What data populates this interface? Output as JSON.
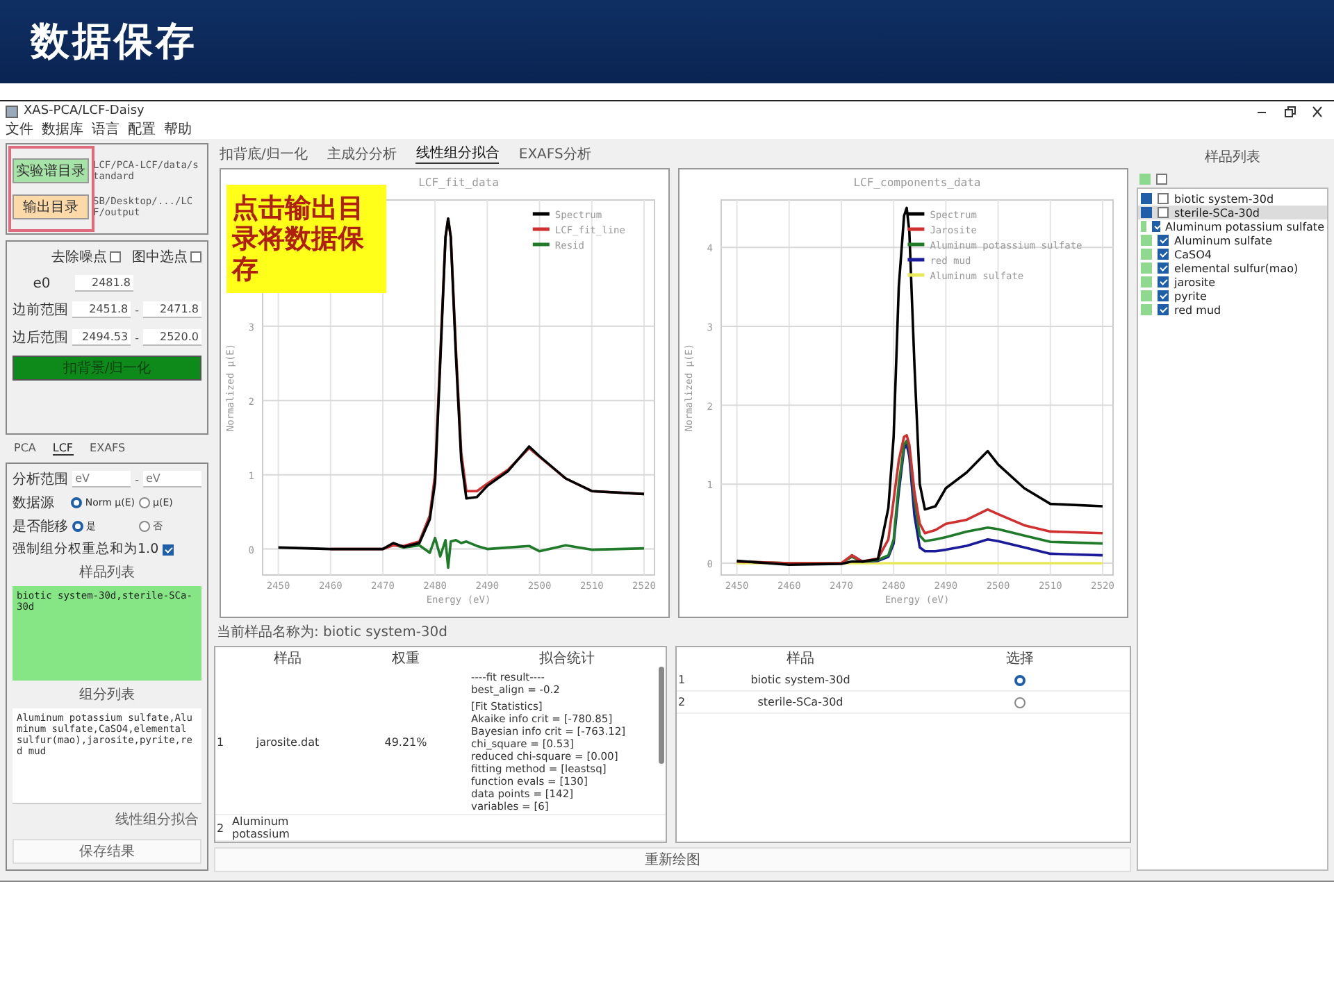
{
  "slide": {
    "title": "数据保存"
  },
  "window": {
    "title": "XAS-PCA/LCF-Daisy"
  },
  "menu": [
    "文件",
    "数据库",
    "语言",
    "配置",
    "帮助"
  ],
  "directories": [
    {
      "kind": "experiment",
      "button": "实验谱目录",
      "path": "LCF/PCA-LCF/data/standard"
    },
    {
      "kind": "output",
      "button": "输出目录",
      "path": "SB/Desktop/.../LCF/output"
    }
  ],
  "callout": "点击输出目录将数据保存",
  "preprocess": {
    "options": [
      {
        "label": "去除噪点",
        "checked": false
      },
      {
        "label": "图中选点",
        "checked": false
      }
    ],
    "e0": {
      "label": "e0",
      "value": "2481.8"
    },
    "separator": "-",
    "ranges": [
      {
        "label": "边前范围",
        "from": "2451.8",
        "to": "2471.8"
      },
      {
        "label": "边后范围",
        "from": "2494.53",
        "to": "2520.0"
      }
    ],
    "button": "扣背景/归一化"
  },
  "method_tabs": [
    {
      "label": "PCA",
      "selected": false
    },
    {
      "label": "LCF",
      "selected": true
    },
    {
      "label": "EXAFS",
      "selected": false
    }
  ],
  "lcf": {
    "range": {
      "label": "分析范围",
      "from_placeholder": "eV",
      "separator": "-",
      "to_placeholder": "eV"
    },
    "radio_groups": [
      {
        "label": "数据源",
        "options": [
          {
            "label": "Norm μ(E)",
            "selected": true
          },
          {
            "label": "μ(E)",
            "selected": false
          }
        ]
      },
      {
        "label": "是否能移",
        "options": [
          {
            "label": "是",
            "selected": true
          },
          {
            "label": "否",
            "selected": false
          }
        ]
      }
    ],
    "constraint": {
      "label": "强制组分权重总和为1.0",
      "checked": true
    },
    "samples_label": "样品列表",
    "samples_text": "biotic system-30d,sterile-SCa-30d",
    "components_label": "组分列表",
    "components_text": "Aluminum potassium sulfate,Aluminum sulfate,CaSO4,elemental sulfur(mao),jarosite,pyrite,red mud",
    "fit_button": "线性组分拟合",
    "save_button": "保存结果"
  },
  "analysis_tabs": [
    {
      "label": "扣背底/归一化",
      "selected": false
    },
    {
      "label": "主成分分析",
      "selected": false
    },
    {
      "label": "线性组分拟合",
      "selected": true
    },
    {
      "label": "EXAFS分析",
      "selected": false
    }
  ],
  "charts": [
    {
      "chart_data": {
        "type": "line",
        "title": "LCF_fit_data",
        "xlabel": "Energy (eV)",
        "ylabel": "Normalized μ(E)",
        "x": [
          2450,
          2460,
          2470,
          2472,
          2474,
          2477,
          2479,
          2480,
          2481,
          2482,
          2482.5,
          2483,
          2484,
          2485,
          2486,
          2488,
          2490,
          2494,
          2498,
          2500,
          2505,
          2510,
          2520
        ],
        "series": [
          {
            "name": "Spectrum",
            "color": "#000000",
            "values": [
              0.02,
              0,
              0,
              0.08,
              0.03,
              0.08,
              0.4,
              0.9,
              2.5,
              4.2,
              4.45,
              4.2,
              2.6,
              1.2,
              0.68,
              0.7,
              0.85,
              1.05,
              1.38,
              1.25,
              0.95,
              0.78,
              0.74
            ]
          },
          {
            "name": "LCF_fit_line",
            "color": "#d03030",
            "values": [
              null,
              0,
              0,
              0.05,
              0.04,
              0.1,
              0.45,
              1.0,
              2.6,
              4.2,
              4.45,
              4.2,
              2.7,
              1.3,
              0.78,
              0.78,
              0.88,
              1.07,
              1.36,
              1.24,
              0.95,
              0.78,
              0.74
            ]
          },
          {
            "name": "Resid",
            "color": "#1f7a2a",
            "values": [
              null,
              null,
              0,
              0.06,
              0.02,
              0.05,
              -0.05,
              0.15,
              -0.1,
              0.12,
              -0.25,
              0.1,
              0.12,
              0.08,
              0.1,
              0.04,
              0,
              0.02,
              0.04,
              -0.03,
              0.05,
              -0.01,
              0.01
            ]
          }
        ],
        "grid": true,
        "legend": true,
        "xlim": [
          2447,
          2522
        ],
        "ylim": [
          -0.35,
          4.7
        ],
        "xticks": [
          2450,
          2460,
          2470,
          2480,
          2490,
          2500,
          2510,
          2520
        ],
        "yticks": [
          0,
          1,
          2,
          3
        ]
      }
    },
    {
      "chart_data": {
        "type": "line",
        "title": "LCF_components_data",
        "xlabel": "Energy (eV)",
        "ylabel": "Normalized μ(E)",
        "x": [
          2450,
          2460,
          2470,
          2472,
          2474,
          2477,
          2479,
          2480,
          2481,
          2482,
          2482.5,
          2483,
          2484,
          2485,
          2486,
          2488,
          2490,
          2494,
          2498,
          2500,
          2505,
          2510,
          2520
        ],
        "series": [
          {
            "name": "Spectrum",
            "color": "#000000",
            "values": [
              0.03,
              -0.02,
              -0.01,
              0.02,
              0.02,
              0.05,
              0.7,
              1.6,
              3.5,
              4.4,
              4.5,
              4.2,
              2.5,
              1.0,
              0.68,
              0.72,
              0.95,
              1.15,
              1.42,
              1.25,
              0.95,
              0.75,
              0.72
            ]
          },
          {
            "name": "Jarosite",
            "color": "#d03030",
            "values": [
              0.02,
              0,
              0,
              0.1,
              0.02,
              0.06,
              0.3,
              0.8,
              1.3,
              1.6,
              1.62,
              1.5,
              0.9,
              0.5,
              0.38,
              0.42,
              0.5,
              0.55,
              0.68,
              0.62,
              0.48,
              0.4,
              0.38
            ]
          },
          {
            "name": "Aluminum potassium sulfate",
            "color": "#1f7a2a",
            "values": [
              0.02,
              0,
              0,
              0.08,
              0.02,
              0.04,
              0.1,
              0.3,
              1.0,
              1.5,
              1.55,
              1.45,
              0.8,
              0.35,
              0.28,
              0.3,
              0.33,
              0.4,
              0.45,
              0.43,
              0.35,
              0.27,
              0.25
            ]
          },
          {
            "name": "red mud",
            "color": "#1a1a9a",
            "values": [
              null,
              null,
              null,
              0.1,
              0.02,
              0.03,
              0.08,
              0.25,
              0.9,
              1.45,
              1.5,
              1.35,
              0.6,
              0.2,
              0.15,
              0.15,
              0.17,
              0.22,
              0.3,
              0.28,
              0.2,
              0.12,
              0.1
            ]
          },
          {
            "name": "Aluminum sulfate",
            "color": "#e8e85a",
            "values": [
              0,
              0,
              0,
              0,
              0,
              0,
              0,
              0,
              0,
              0,
              0,
              0,
              0,
              0,
              0,
              0,
              0,
              0,
              0,
              0,
              0,
              0,
              0
            ]
          }
        ],
        "grid": true,
        "legend": true,
        "xlim": [
          2447,
          2522
        ],
        "ylim": [
          -0.15,
          4.6
        ],
        "xticks": [
          2450,
          2460,
          2470,
          2480,
          2490,
          2500,
          2510,
          2520
        ],
        "yticks": [
          0,
          1,
          2,
          3,
          4
        ]
      }
    }
  ],
  "current_sample": "当前样品名称为: biotic system-30d",
  "results_table": {
    "columns": [
      "样品",
      "权重",
      "拟合统计"
    ],
    "rows": [
      {
        "index": "1",
        "sample": "jarosite.dat",
        "weight": "49.21%",
        "stats": [
          [
            "----fit result----",
            "best_align = -0.2"
          ],
          [
            "[Fit Statistics]",
            "Akaike info crit = [-780.85]",
            "Bayesian info crit = [-763.12]",
            "chi_square = [0.53]",
            "reduced chi-square = [0.00]",
            "fitting method = [leastsq]",
            "function evals = [130]",
            "data points = [142]",
            "variables = [6]"
          ]
        ]
      },
      {
        "index": "2",
        "sample": "Aluminum potassium"
      }
    ]
  },
  "redraw_button": "重新绘图",
  "sample_select": {
    "columns": [
      "样品",
      "选择"
    ],
    "rows": [
      {
        "index": "1",
        "name": "biotic system-30d",
        "selected": true
      },
      {
        "index": "2",
        "name": "sterile-SCa-30d",
        "selected": false
      }
    ]
  },
  "sample_list": {
    "title": "样品列表",
    "header_checked": false,
    "items": [
      {
        "label": "biotic system-30d",
        "color": "#1f5fa8",
        "checked": false,
        "selected": false
      },
      {
        "label": "sterile-SCa-30d",
        "color": "#1f5fa8",
        "checked": false,
        "selected": true
      },
      {
        "label": "Aluminum potassium sulfate",
        "color": "#8fd88f",
        "checked": true,
        "selected": false
      },
      {
        "label": "Aluminum sulfate",
        "color": "#8fd88f",
        "checked": true,
        "selected": false
      },
      {
        "label": "CaSO4",
        "color": "#8fd88f",
        "checked": true,
        "selected": false
      },
      {
        "label": "elemental sulfur(mao)",
        "color": "#8fd88f",
        "checked": true,
        "selected": false
      },
      {
        "label": "jarosite",
        "color": "#8fd88f",
        "checked": true,
        "selected": false
      },
      {
        "label": "pyrite",
        "color": "#8fd88f",
        "checked": true,
        "selected": false
      },
      {
        "label": "red mud",
        "color": "#8fd88f",
        "checked": true,
        "selected": false
      }
    ]
  }
}
